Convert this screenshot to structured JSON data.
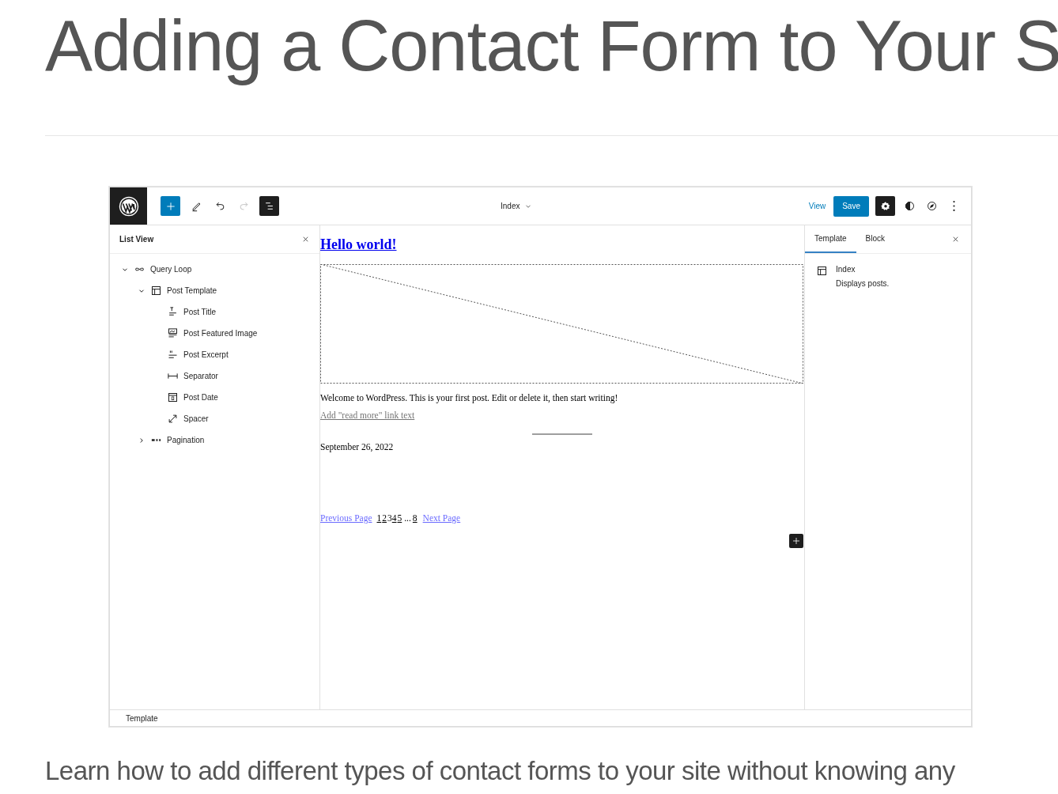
{
  "article": {
    "title": "Adding a Contact Form to Your S",
    "lede": "Learn how to add different types of contact forms to your site without knowing any"
  },
  "editor": {
    "toolbar": {
      "template_name": "Index",
      "view": "View",
      "save": "Save",
      "redo_disabled": true,
      "list_view_on": true,
      "settings_on": true
    },
    "list_view": {
      "title": "List View",
      "tree": [
        {
          "label": "Query Loop",
          "kind": "loop",
          "expanded": true,
          "children": [
            {
              "label": "Post Template",
              "kind": "template",
              "expanded": true,
              "children": [
                {
                  "label": "Post Title",
                  "kind": "title"
                },
                {
                  "label": "Post Featured Image",
                  "kind": "image"
                },
                {
                  "label": "Post Excerpt",
                  "kind": "excerpt"
                },
                {
                  "label": "Separator",
                  "kind": "separator"
                },
                {
                  "label": "Post Date",
                  "kind": "date"
                },
                {
                  "label": "Spacer",
                  "kind": "spacer"
                }
              ]
            },
            {
              "label": "Pagination",
              "kind": "pagination",
              "expanded": false
            }
          ]
        }
      ]
    },
    "canvas": {
      "post_title": "Hello world!",
      "excerpt": "Welcome to WordPress. This is your first post. Edit or delete it, then start writing!",
      "read_more": "Add \"read more\" link text",
      "date": "September 26, 2022",
      "pagination": {
        "previous": "Previous Page",
        "next": "Next Page",
        "pages": [
          {
            "label": "1",
            "kind": "link"
          },
          {
            "label": "2",
            "kind": "link"
          },
          {
            "label": "3",
            "kind": "current"
          },
          {
            "label": "4",
            "kind": "link"
          },
          {
            "label": "5",
            "kind": "link"
          },
          {
            "label": "...",
            "kind": "dots"
          },
          {
            "label": "8",
            "kind": "link"
          }
        ]
      }
    },
    "sidebar": {
      "tabs": [
        {
          "label": "Template",
          "selected": true
        },
        {
          "label": "Block",
          "selected": false
        }
      ],
      "template": {
        "name": "Index",
        "description": "Displays posts."
      }
    },
    "footer": "Template"
  }
}
